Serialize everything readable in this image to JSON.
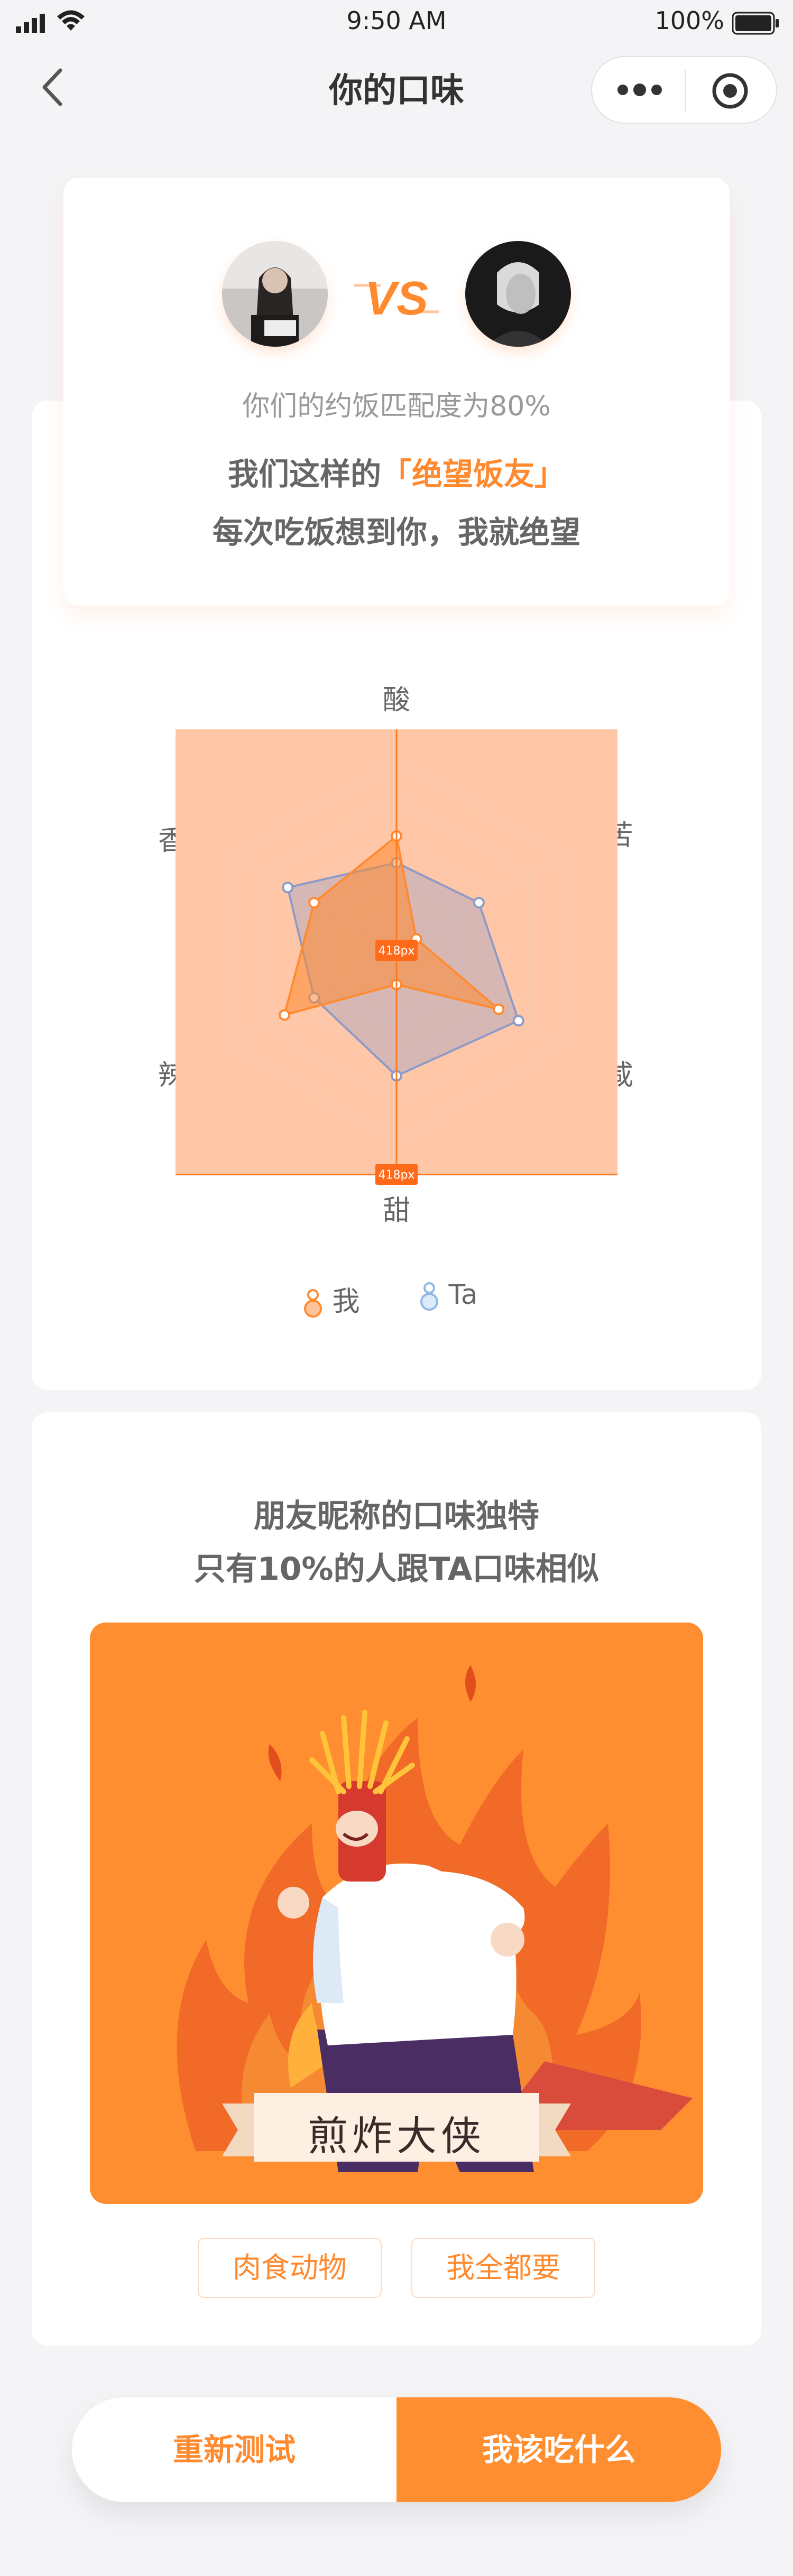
{
  "status_bar": {
    "time": "9:50 AM",
    "battery_text": "100%"
  },
  "nav": {
    "title": "你的口味"
  },
  "match": {
    "percent_text": "你们的约饭匹配度为80%",
    "line1_prefix": "我们这样的",
    "line1_highlight": "「绝望饭友」",
    "line2": "每次吃饭想到你，我就绝望",
    "vs_text": "VS"
  },
  "chart_data": {
    "type": "radar",
    "axes": [
      "酸",
      "苦",
      "咸",
      "甜",
      "辣",
      "香"
    ],
    "range": [
      0,
      5
    ],
    "series": [
      {
        "name": "我",
        "color": "#FF8A2F",
        "values": [
          3,
          0.6,
          3.1,
          0.9,
          3.4,
          2.5
        ]
      },
      {
        "name": "Ta",
        "color": "#8C9BC8",
        "values": [
          2.3,
          2.5,
          3.7,
          3.3,
          2.5,
          3.3
        ]
      }
    ],
    "dimension_badges": [
      "418px",
      "418px"
    ]
  },
  "legend": {
    "me": "我",
    "ta": "Ta"
  },
  "food": {
    "line1": "朋友昵称的口味独特",
    "line2": "只有10%的人跟TA口味相似",
    "banner": "煎炸大侠",
    "tags": [
      "肉食动物",
      "我全都要"
    ]
  },
  "buttons": {
    "retest": "重新测试",
    "what_to_eat": "我该吃什么"
  },
  "colors": {
    "accent": "#FF8E30",
    "radar_me": "#FF8A2F",
    "radar_ta": "#8C9BC8"
  }
}
